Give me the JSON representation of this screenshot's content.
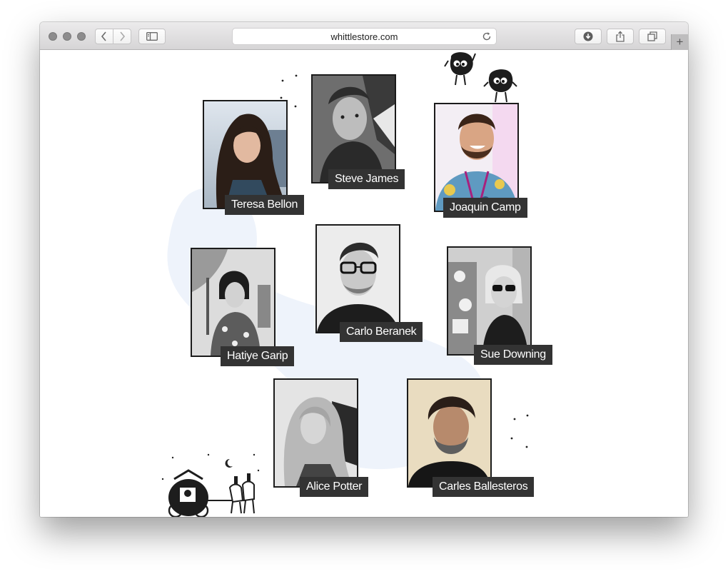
{
  "browser": {
    "url": "whittlestore.com",
    "new_tab": "+"
  },
  "colors": {
    "label_bg": "#333333",
    "label_text": "#ffffff",
    "frame": "#1b1b1b",
    "blob": "#eef3fb"
  },
  "people": [
    {
      "name": "Teresa Bellon"
    },
    {
      "name": "Steve James"
    },
    {
      "name": "Joaquin Camp"
    },
    {
      "name": "Hatiye Garip"
    },
    {
      "name": "Carlo Beranek"
    },
    {
      "name": "Sue Downing"
    },
    {
      "name": "Alice Potter"
    },
    {
      "name": "Carles Ballesteros"
    }
  ],
  "icons": [
    "back-chevron-icon",
    "forward-chevron-icon",
    "sidebar-icon",
    "reload-icon",
    "download-icon",
    "share-icon",
    "tabs-icon"
  ]
}
